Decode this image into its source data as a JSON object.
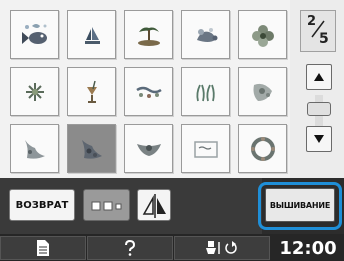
{
  "pagination": {
    "current": "2",
    "total": "5"
  },
  "grid": {
    "patterns": [
      {
        "icon": "fish-icon"
      },
      {
        "icon": "sailboat-icon"
      },
      {
        "icon": "palm-island-icon"
      },
      {
        "icon": "sea-creature-icon"
      },
      {
        "icon": "hibiscus-flower-icon"
      },
      {
        "icon": "starburst-flower-icon"
      },
      {
        "icon": "tropical-drink-icon"
      },
      {
        "icon": "sea-border-icon"
      },
      {
        "icon": "seaweed-icon"
      },
      {
        "icon": "lace-flower-icon"
      },
      {
        "icon": "lace-corner-icon"
      },
      {
        "icon": "lace-corner-selected-icon"
      },
      {
        "icon": "heart-garland-icon"
      },
      {
        "icon": "lace-frame-text-icon"
      },
      {
        "icon": "flower-wreath-icon"
      }
    ],
    "selected_index": 11
  },
  "toolbar": {
    "back_label": "ВОЗВРАТ",
    "embroidery_label": "ВЫШИВАНИЕ"
  },
  "status": {
    "time": "12:00"
  },
  "colors": {
    "highlight": "#1f8fd8",
    "bar": "#2c2c2c"
  }
}
